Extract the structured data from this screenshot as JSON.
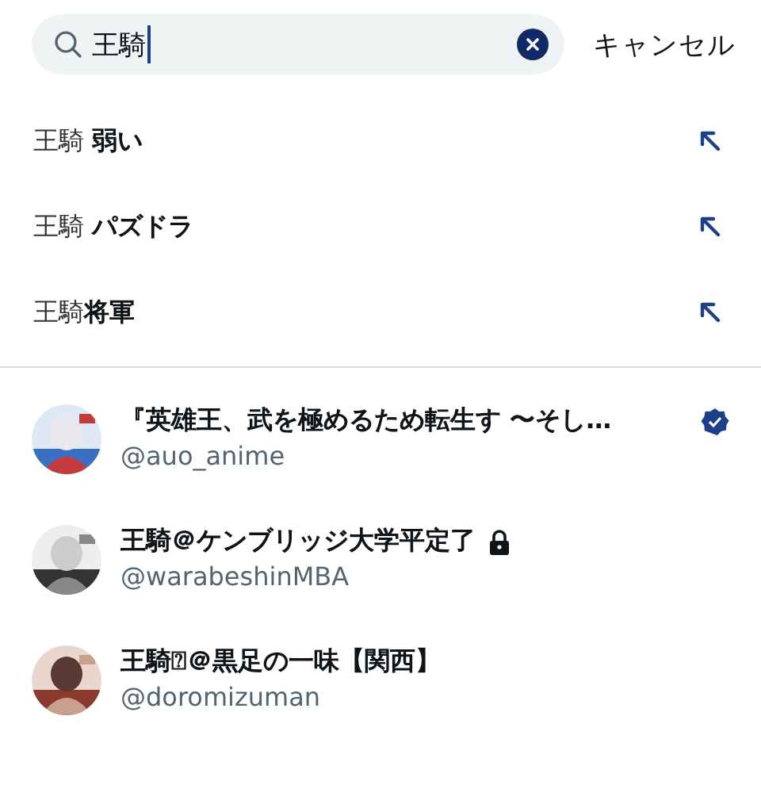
{
  "search": {
    "value": "王騎",
    "cancel": "キャンセル"
  },
  "suggestions": [
    {
      "text": "王騎 **弱い**"
    },
    {
      "text": "王騎 **パズドラ**"
    },
    {
      "text": "王騎**将軍**"
    }
  ],
  "users": [
    {
      "name": "『英雄王、武を極めるため転生す 〜そし…",
      "handle": "@auo_anime",
      "verified": true,
      "locked": false
    },
    {
      "name": "王騎＠ケンブリッジ大学平定了",
      "handle": "@warabeshinMBA",
      "verified": false,
      "locked": true
    },
    {
      "name": "王騎⍰＠黒足の一味【関西】",
      "handle": "@doromizuman",
      "verified": false,
      "locked": false
    }
  ]
}
